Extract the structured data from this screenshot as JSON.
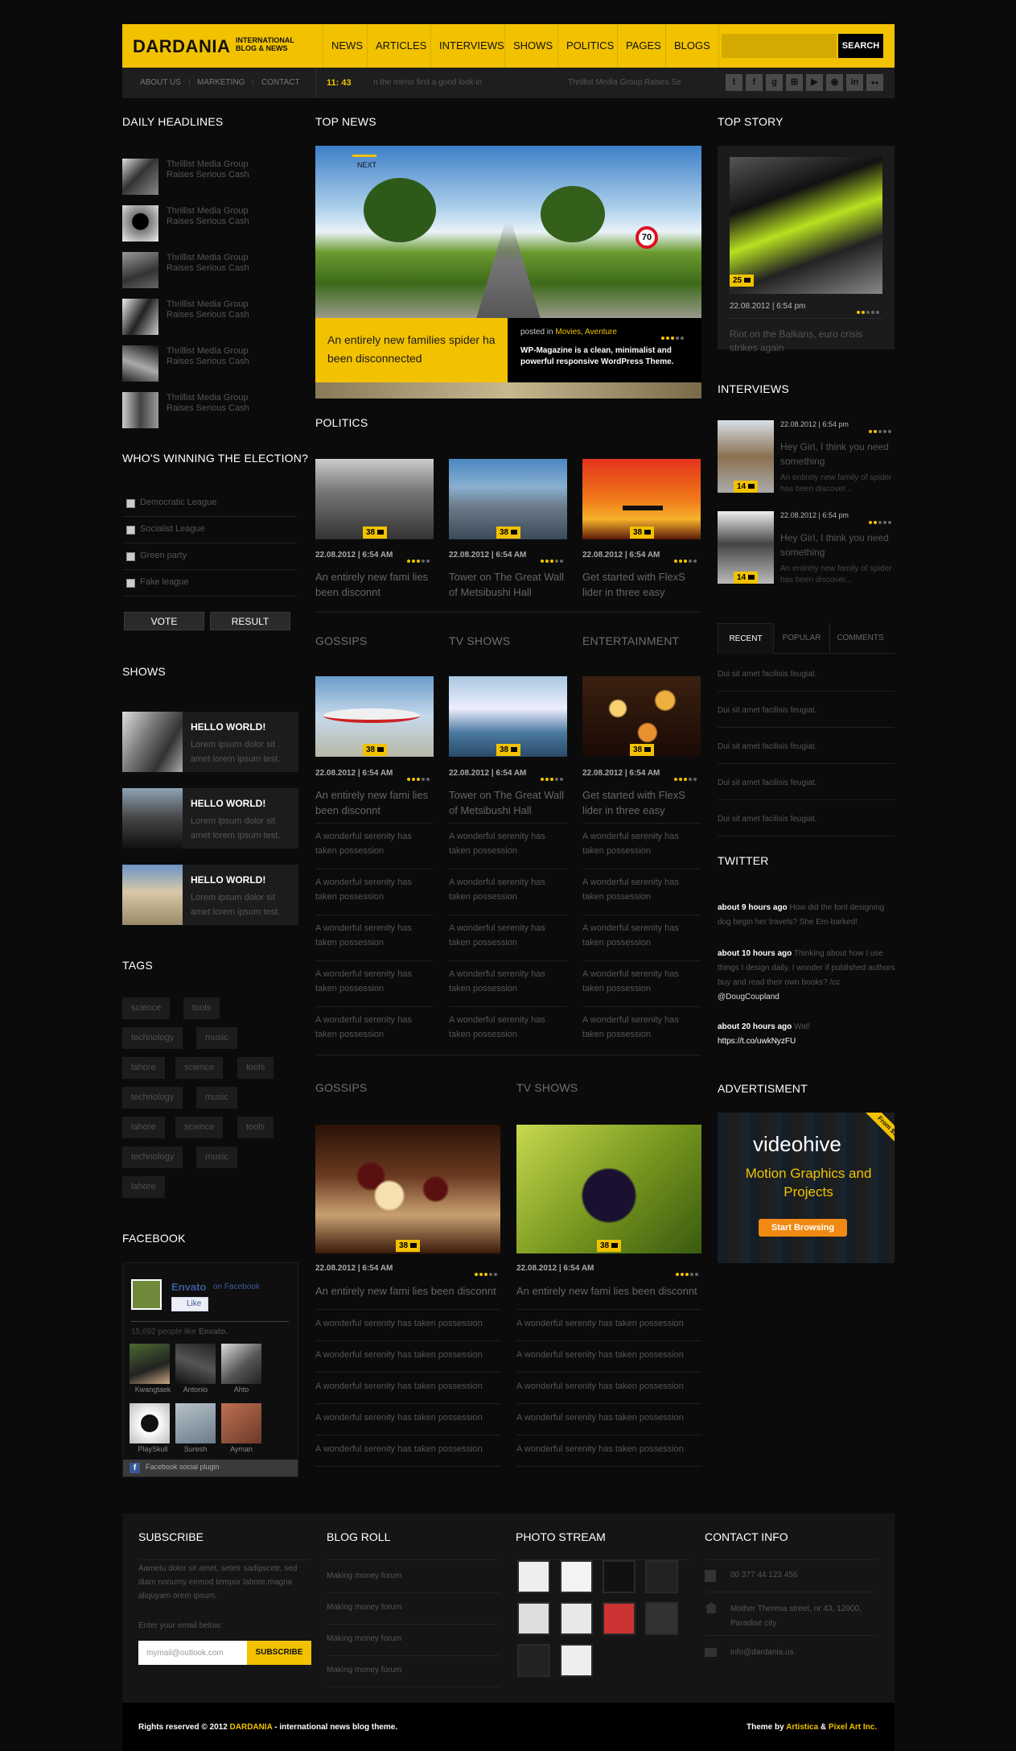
{
  "header": {
    "logo": "DARDANIA",
    "tagline": "INTERNATIONAL BLOG & NEWS",
    "nav": [
      "NEWS",
      "ARTICLES",
      "INTERVIEWS",
      "SHOWS",
      "POLITICS",
      "PAGES",
      "BLOGS"
    ],
    "search_label": "SEARCH",
    "search_placeholder": "",
    "sub_links": [
      "ABOUT US",
      "MARKETING",
      "CONTACT"
    ],
    "ticker_time": "11: 43",
    "ticker_items": [
      "n the mirror first a good look in",
      "Thrillist Media Group Raises Se"
    ],
    "social_icons": [
      "twitter-icon",
      "facebook-icon",
      "google-icon",
      "windows-icon",
      "youtube-icon",
      "rss-icon",
      "linkedin-icon",
      "flickr-icon"
    ],
    "social_glyphs": [
      "t",
      "f",
      "g",
      "⊞",
      "▶",
      "◉",
      "in",
      "●●"
    ]
  },
  "colors": {
    "accent": "#f2c200",
    "background": "#0b0b0b",
    "panel": "#1c1c1c"
  },
  "left": {
    "daily_title": "DAILY HEADLINES",
    "daily": [
      "Thrillist Media Group Raises Serious Cash",
      "Thrillist Media Group Raises Serious Cash",
      "Thrillist Media Group Raises Serious Cash",
      "Thrillist Media Group Raises Serious Cash",
      "Thrillist Media Group Raises Serious Cash",
      "Thrillist Media Group Raises Serious Cash"
    ],
    "poll_title": "WHO'S WINNING THE ELECTION?",
    "poll_options": [
      "Democratic League",
      "Socialist League",
      "Green party",
      "Fake league"
    ],
    "vote": "VOTE",
    "result": "RESULT",
    "shows_title": "SHOWS",
    "shows": [
      {
        "title": "HELLO WORLD!",
        "text": "Lorem ipsum dolor sit amet lorem ipsum test."
      },
      {
        "title": "HELLO WORLD!",
        "text": "Lorem ipsum dolor sit amet lorem ipsum test."
      },
      {
        "title": "HELLO WORLD!",
        "text": "Lorem ipsum dolor sit amet lorem ipsum test."
      }
    ],
    "tags_title": "TAGS",
    "tags": [
      [
        "science",
        "tools"
      ],
      [
        "technology",
        "music"
      ],
      [
        "lahore",
        "science",
        "tools"
      ],
      [
        "technology",
        "music"
      ],
      [
        "lahore",
        "science",
        "tools"
      ],
      [
        "technology",
        "music"
      ],
      [
        "lahore"
      ]
    ],
    "facebook_title": "FACEBOOK",
    "fb": {
      "page": "Envato",
      "on": "on Facebook",
      "like": "Like",
      "count": "15,692 people like",
      "count_name": "Envato.",
      "faces": [
        "Kwangtaek",
        "Antonio",
        "Ahto",
        "PlaySkull",
        "Suresh",
        "Ayman"
      ],
      "plugin": "Facebook social plugin"
    }
  },
  "center": {
    "top_news_title": "TOP NEWS",
    "slider_next": "NEXT",
    "slider_caption": "An entirely new families spider ha been disconnected",
    "slider_posted": "posted in",
    "slider_cats": "Movies, Aventure",
    "slider_desc": "WP-Magazine is a clean, minimalist and powerful responsive WordPress Theme.",
    "politics_title": "POLITICS",
    "politics": [
      {
        "date": "22.08.2012 | 6:54 AM",
        "title": "An entirely new fami lies been disconnt",
        "comments": "38"
      },
      {
        "date": "22.08.2012 | 6:54 AM",
        "title": "Tower on The Great Wall of Metsibushi Hall",
        "comments": "38"
      },
      {
        "date": "22.08.2012 | 6:54 AM",
        "title": "Get started with FlexS lider in three easy",
        "comments": "38"
      }
    ],
    "cols": [
      {
        "title": "GOSSIPS",
        "date": "22.08.2012 | 6:54 AM",
        "head": "An entirely new fami lies been disconnt",
        "comments": "38"
      },
      {
        "title": "TV SHOWS",
        "date": "22.08.2012 | 6:54 AM",
        "head": "Tower on The Great Wall of Metsibushi Hall",
        "comments": "38"
      },
      {
        "title": "ENTERTAINMENT",
        "date": "22.08.2012 | 6:54 AM",
        "head": "Get started with FlexS lider in three easy",
        "comments": "38"
      }
    ],
    "wonderful": "A wonderful serenity has taken possession",
    "bottom": [
      {
        "title": "GOSSIPS",
        "date": "22.08.2012 | 6:54 AM",
        "head": "An entirely new fami lies been disconnt",
        "comments": "38"
      },
      {
        "title": "TV SHOWS",
        "date": "22.08.2012 | 6:54 AM",
        "head": "An entirely new fami lies been disconnt",
        "comments": "38"
      }
    ]
  },
  "right": {
    "top_story_title": "TOP STORY",
    "top_story_date": "22.08.2012 | 6:54 pm",
    "top_story_comments": "25",
    "top_story_text": "Riot on the Balkans, euro crisis strikes again",
    "interviews_title": "INTERVIEWS",
    "interviews": [
      {
        "date": "22.08.2012 | 6:54 pm",
        "title": "Hey Girl, I think you need something",
        "text": "An entirely new family of spider has been discover...",
        "comments": "14"
      },
      {
        "date": "22.08.2012 | 6:54 pm",
        "title": "Hey Girl, I think you need something",
        "text": "An entirely new family of spider has been discover...",
        "comments": "14"
      }
    ],
    "tabs": [
      "RECENT",
      "POPULAR",
      "COMMENTS"
    ],
    "recent": [
      "Dui sit amet facilisis feugiat.",
      "Dui sit amet facilisis feugiat.",
      "Dui sit amet facilisis feugiat.",
      "Dui sit amet facilisis feugiat.",
      "Dui sit amet facilisis feugiat."
    ],
    "twitter_title": "TWITTER",
    "tweets": [
      {
        "time": "about 9 hours ago",
        "text": "How did the font designing dog begin her travels? She Em-barked!"
      },
      {
        "time": "about 10 hours ago",
        "text": "Thinking about how I use things I design daily. I wonder if published authors buy and read their own books? /cc",
        "handle": "@DougCoupland"
      },
      {
        "time": "about 20 hours ago",
        "text": "Wat!",
        "link": "https://t.co/uwkNyzFU"
      }
    ],
    "ad_title": "ADVERTISMENT",
    "ad": {
      "ribbon": "From $5",
      "brand": "videohive",
      "headline": "Motion Graphics and Projects",
      "cta": "Start Browsing"
    }
  },
  "footer": {
    "subscribe_title": "SUBSCRIBE",
    "subscribe_text": "Aametu dolor sit amet, setetr sadipscetr, sed diam nonumy eirmod tempor labore.magna aliquyam orem ipsum.",
    "email_label": "Enter your email below:",
    "email_value": "mymail@outlook.com",
    "subscribe_btn": "SUBSCRIBE",
    "blogroll_title": "BLOG ROLL",
    "blogroll": [
      "Making money forum",
      "Making money forum",
      "Making money forum",
      "Making money forum"
    ],
    "photos_title": "PHOTO STREAM",
    "contact_title": "CONTACT INFO",
    "phone": "00 377 44 123 456",
    "address": "Mother Theresa street, nr 43, 12000, Paradise city",
    "email": "info@dardania.us",
    "copy_pre": "Rights reserved © 2012",
    "copy_brand": "DARDANIA",
    "copy_post": "- international news blog theme.",
    "theme_by": "Theme by",
    "credit1": "Artistica",
    "amp": "&",
    "credit2": "Pixel Art Inc."
  }
}
